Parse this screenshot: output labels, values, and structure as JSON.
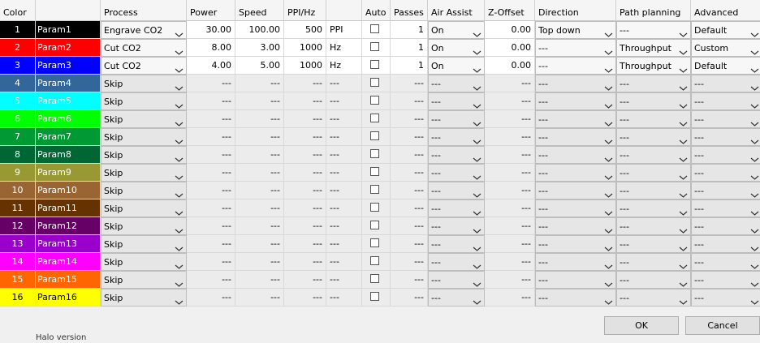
{
  "headers": [
    "Color",
    "",
    "Process",
    "Power",
    "Speed",
    "PPI/Hz",
    "",
    "Auto",
    "Passes",
    "Air Assist",
    "Z-Offset",
    "Direction",
    "Path planning",
    "Advanced"
  ],
  "rows": [
    {
      "num": "1",
      "color": "#000000",
      "text_color": "#ffffff",
      "name": "Param1",
      "process": "Engrave CO2",
      "power": "30.00",
      "speed": "100.00",
      "ppi": "500",
      "unit": "PPI",
      "passes": "1",
      "air": "On",
      "z": "0.00",
      "direction": "Top down",
      "path": "---",
      "advanced": "Default",
      "active": true
    },
    {
      "num": "2",
      "color": "#ff0000",
      "text_color": "#ffffff",
      "name": "Param2",
      "process": "Cut CO2",
      "power": "8.00",
      "speed": "3.00",
      "ppi": "1000",
      "unit": "Hz",
      "passes": "1",
      "air": "On",
      "z": "0.00",
      "direction": "---",
      "path": "Throughput",
      "advanced": "Custom",
      "active": true
    },
    {
      "num": "3",
      "color": "#0000ff",
      "text_color": "#ffffff",
      "name": "Param3",
      "process": "Cut CO2",
      "power": "4.00",
      "speed": "5.00",
      "ppi": "1000",
      "unit": "Hz",
      "passes": "1",
      "air": "On",
      "z": "0.00",
      "direction": "---",
      "path": "Throughput",
      "advanced": "Default",
      "active": true
    },
    {
      "num": "4",
      "color": "#336699",
      "text_color": "#ffffff",
      "name": "Param4",
      "process": "Skip",
      "power": "---",
      "speed": "---",
      "ppi": "---",
      "unit": "---",
      "passes": "---",
      "air": "---",
      "z": "---",
      "direction": "---",
      "path": "---",
      "advanced": "---",
      "active": false
    },
    {
      "num": "5",
      "color": "#00ffff",
      "text_color": "#ffffff",
      "name": "Param5",
      "process": "Skip",
      "power": "---",
      "speed": "---",
      "ppi": "---",
      "unit": "---",
      "passes": "---",
      "air": "---",
      "z": "---",
      "direction": "---",
      "path": "---",
      "advanced": "---",
      "active": false
    },
    {
      "num": "6",
      "color": "#00ff00",
      "text_color": "#ffffff",
      "name": "Param6",
      "process": "Skip",
      "power": "---",
      "speed": "---",
      "ppi": "---",
      "unit": "---",
      "passes": "---",
      "air": "---",
      "z": "---",
      "direction": "---",
      "path": "---",
      "advanced": "---",
      "active": false
    },
    {
      "num": "7",
      "color": "#009933",
      "text_color": "#ffffff",
      "name": "Param7",
      "process": "Skip",
      "power": "---",
      "speed": "---",
      "ppi": "---",
      "unit": "---",
      "passes": "---",
      "air": "---",
      "z": "---",
      "direction": "---",
      "path": "---",
      "advanced": "---",
      "active": false
    },
    {
      "num": "8",
      "color": "#006633",
      "text_color": "#ffffff",
      "name": "Param8",
      "process": "Skip",
      "power": "---",
      "speed": "---",
      "ppi": "---",
      "unit": "---",
      "passes": "---",
      "air": "---",
      "z": "---",
      "direction": "---",
      "path": "---",
      "advanced": "---",
      "active": false
    },
    {
      "num": "9",
      "color": "#999933",
      "text_color": "#ffffff",
      "name": "Param9",
      "process": "Skip",
      "power": "---",
      "speed": "---",
      "ppi": "---",
      "unit": "---",
      "passes": "---",
      "air": "---",
      "z": "---",
      "direction": "---",
      "path": "---",
      "advanced": "---",
      "active": false
    },
    {
      "num": "10",
      "color": "#996633",
      "text_color": "#ffffff",
      "name": "Param10",
      "process": "Skip",
      "power": "---",
      "speed": "---",
      "ppi": "---",
      "unit": "---",
      "passes": "---",
      "air": "---",
      "z": "---",
      "direction": "---",
      "path": "---",
      "advanced": "---",
      "active": false
    },
    {
      "num": "11",
      "color": "#663300",
      "text_color": "#ffffff",
      "name": "Param11",
      "process": "Skip",
      "power": "---",
      "speed": "---",
      "ppi": "---",
      "unit": "---",
      "passes": "---",
      "air": "---",
      "z": "---",
      "direction": "---",
      "path": "---",
      "advanced": "---",
      "active": false
    },
    {
      "num": "12",
      "color": "#660066",
      "text_color": "#ffffff",
      "name": "Param12",
      "process": "Skip",
      "power": "---",
      "speed": "---",
      "ppi": "---",
      "unit": "---",
      "passes": "---",
      "air": "---",
      "z": "---",
      "direction": "---",
      "path": "---",
      "advanced": "---",
      "active": false
    },
    {
      "num": "13",
      "color": "#9900cc",
      "text_color": "#ffffff",
      "name": "Param13",
      "process": "Skip",
      "power": "---",
      "speed": "---",
      "ppi": "---",
      "unit": "---",
      "passes": "---",
      "air": "---",
      "z": "---",
      "direction": "---",
      "path": "---",
      "advanced": "---",
      "active": false
    },
    {
      "num": "14",
      "color": "#ff00ff",
      "text_color": "#ffffff",
      "name": "Param14",
      "process": "Skip",
      "power": "---",
      "speed": "---",
      "ppi": "---",
      "unit": "---",
      "passes": "---",
      "air": "---",
      "z": "---",
      "direction": "---",
      "path": "---",
      "advanced": "---",
      "active": false
    },
    {
      "num": "15",
      "color": "#ff6600",
      "text_color": "#ffffff",
      "name": "Param15",
      "process": "Skip",
      "power": "---",
      "speed": "---",
      "ppi": "---",
      "unit": "---",
      "passes": "---",
      "air": "---",
      "z": "---",
      "direction": "---",
      "path": "---",
      "advanced": "---",
      "active": false
    },
    {
      "num": "16",
      "color": "#ffff00",
      "text_color": "#000000",
      "name": "Param16",
      "process": "Skip",
      "power": "---",
      "speed": "---",
      "ppi": "---",
      "unit": "---",
      "passes": "---",
      "air": "---",
      "z": "---",
      "direction": "---",
      "path": "---",
      "advanced": "---",
      "active": false
    }
  ],
  "buttons": {
    "ok": "OK",
    "cancel": "Cancel"
  },
  "background_text": "Halo version"
}
